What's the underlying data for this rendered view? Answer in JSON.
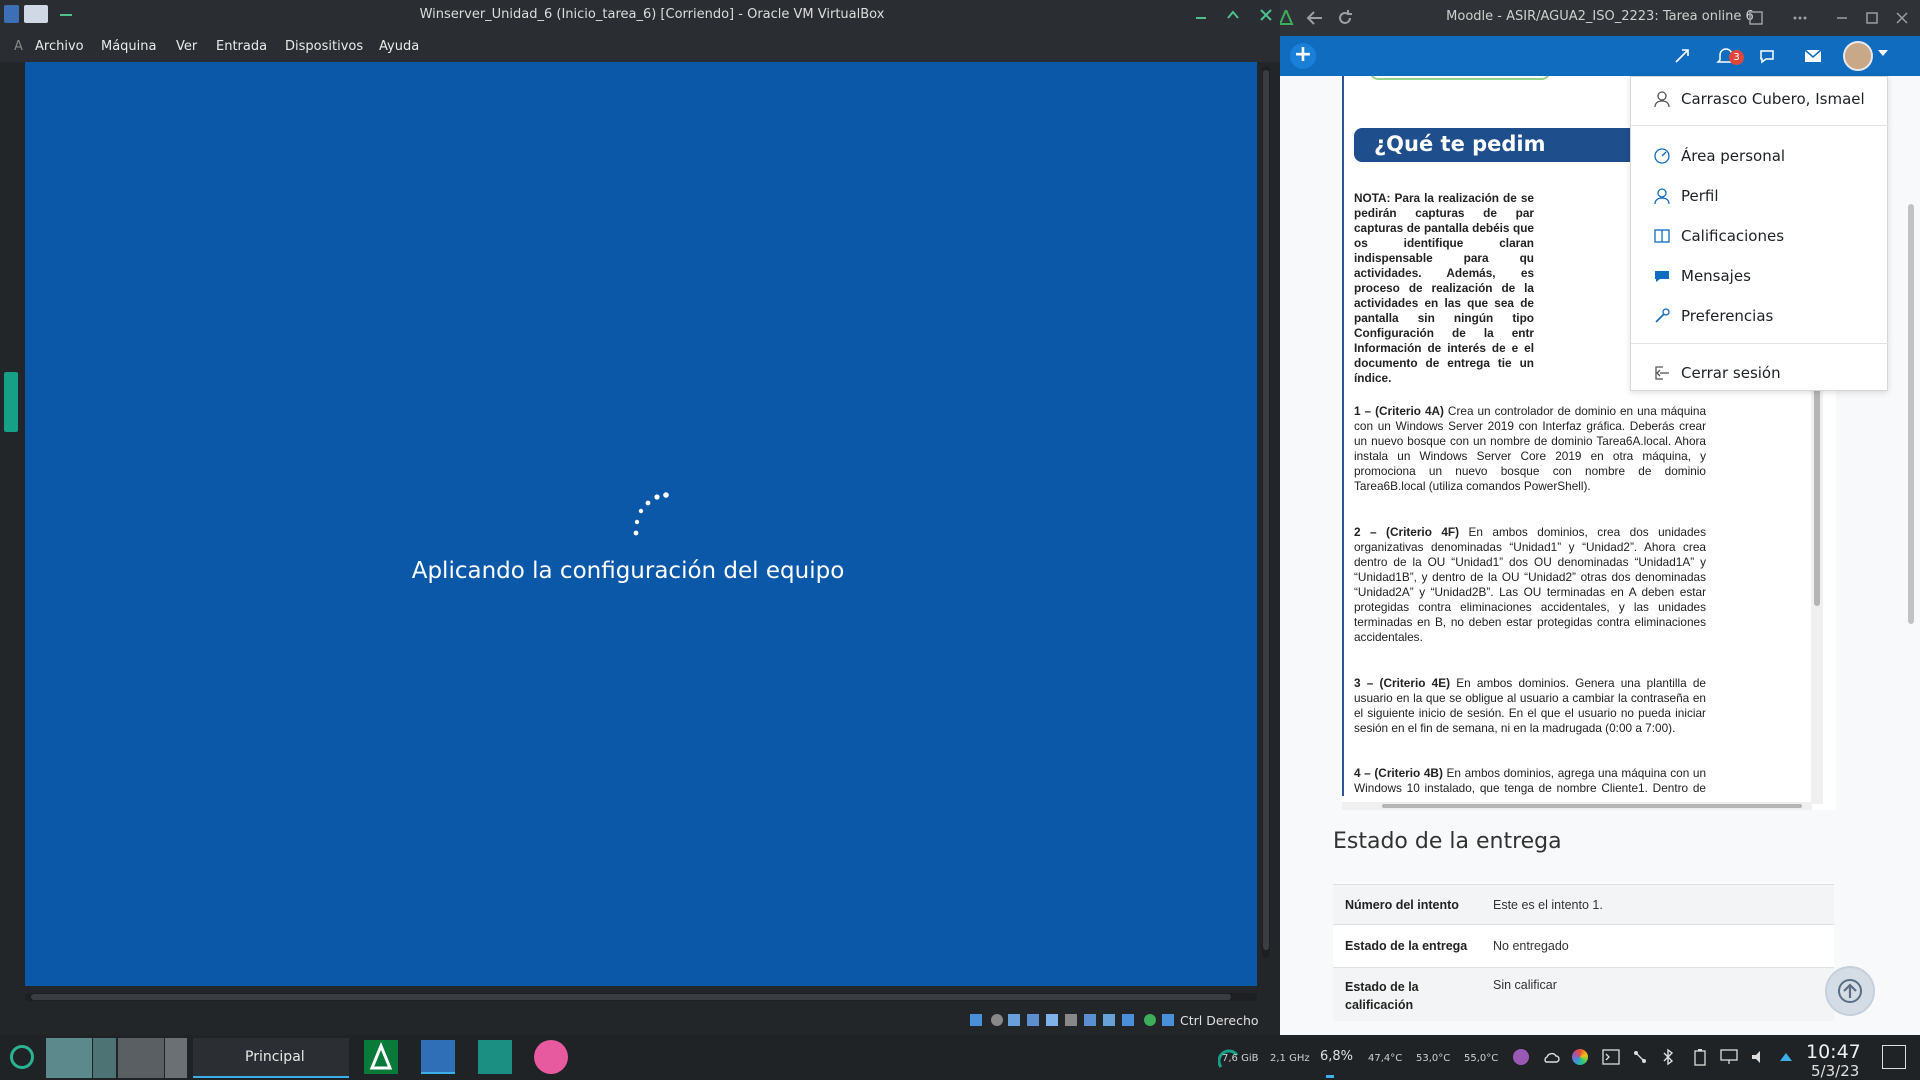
{
  "vbox": {
    "title": "Winserver_Unidad_6 (Inicio_tarea_6) [Corriendo] - Oracle VM VirtualBox",
    "menu": [
      "Archivo",
      "Máquina",
      "Ver",
      "Entrada",
      "Dispositivos",
      "Ayuda"
    ],
    "menu_stub": "A",
    "guest_message": "Aplicando la configuración del equipo",
    "host_key": "Ctrl Derecho",
    "screen_color": "#0b57a8"
  },
  "browser": {
    "title": "Moodle - ASIR/AGUA2_ISO_2223: Tarea online 6",
    "notifications_count": "3",
    "accent": "#0f6cbf"
  },
  "document": {
    "heading": "¿Qué te pedim",
    "note": "NOTA: Para la realización de se pedirán capturas de par capturas de pantalla debéis que os identifique claran indispensable para qu actividades. Además, es proceso de realización de la actividades en las que sea de pantalla sin ningún tipo Configuración de la entr Información de interés de e el documento de entrega tie un índice.",
    "items": [
      {
        "label": "1 – (Criterio 4A)",
        "text": " Crea un controlador de dominio en una máquina con un Windows Server 2019 con Interfaz gráfica. Deberás crear un nuevo bosque con un nombre de dominio Tarea6A.local. Ahora instala un Windows Server Core 2019 en otra máquina, y promociona un nuevo bosque con nombre de dominio Tarea6B.local (utiliza comandos PowerShell)."
      },
      {
        "label": "2 – (Criterio 4F)",
        "text": " En ambos dominios, crea dos unidades organizativas denominadas “Unidad1” y “Unidad2”. Ahora crea dentro de la OU “Unidad1” dos OU denominadas “Unidad1A” y “Unidad1B”, y dentro de la OU “Unidad2” otras dos denominadas “Unidad2A” y “Unidad2B”. Las OU terminadas en A deben estar protegidas contra eliminaciones accidentales, y las unidades terminadas en B, no deben estar protegidas contra eliminaciones accidentales."
      },
      {
        "label": "3 – (Criterio 4E)",
        "text": " En ambos dominios. Genera una plantilla de usuario en la que se obligue al usuario a cambiar la contraseña en el siguiente inicio de sesión. En el que el usuario no pueda iniciar sesión en el fin de semana, ni en la madrugada (0:00 a 7:00)."
      },
      {
        "label": "4 – (Criterio 4B)",
        "text": " En ambos dominios, agrega una máquina con un Windows 10 instalado, que tenga de nombre Cliente1. Dentro de cada unidad organizativa, utilizando la"
      }
    ]
  },
  "submission": {
    "title": "Estado de la entrega",
    "rows": [
      {
        "label": "Número del intento",
        "value": "Este es el intento 1."
      },
      {
        "label": "Estado de la entrega",
        "value": "No entregado"
      },
      {
        "label": "Estado de la calificación",
        "value": "Sin calificar"
      }
    ]
  },
  "user_menu": {
    "name": "Carrasco Cubero, Ismael",
    "items": [
      {
        "label": "Área personal",
        "icon": "dashboard-icon"
      },
      {
        "label": "Perfil",
        "icon": "user-icon"
      },
      {
        "label": "Calificaciones",
        "icon": "grades-icon"
      },
      {
        "label": "Mensajes",
        "icon": "chat-icon"
      },
      {
        "label": "Preferencias",
        "icon": "wrench-icon"
      }
    ],
    "logout": "Cerrar sesión"
  },
  "taskbar": {
    "task_label": "Principal",
    "ram": "7,6 GiB",
    "cpu_freq": "2,1 GHz",
    "cpu_load": "6,8%",
    "temps": [
      "47,4°C",
      "53,0°C",
      "55,0°C"
    ],
    "time": "10:47",
    "date": "5/3/23"
  }
}
